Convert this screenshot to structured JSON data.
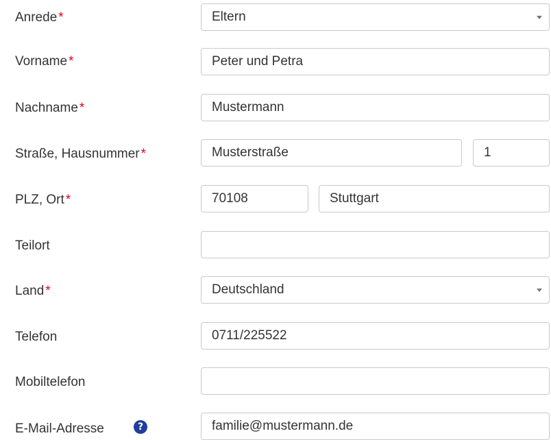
{
  "form": {
    "required_marker": "*",
    "anrede": {
      "label": "Anrede",
      "value": "Eltern"
    },
    "vorname": {
      "label": "Vorname",
      "value": "Peter und Petra"
    },
    "nachname": {
      "label": "Nachname",
      "value": "Mustermann"
    },
    "strasse": {
      "label": "Straße, Hausnummer",
      "street_value": "Musterstraße",
      "number_value": "1"
    },
    "plz_ort": {
      "label": "PLZ, Ort",
      "plz_value": "70108",
      "ort_value": "Stuttgart"
    },
    "teilort": {
      "label": "Teilort",
      "value": ""
    },
    "land": {
      "label": "Land",
      "value": "Deutschland"
    },
    "telefon": {
      "label": "Telefon",
      "value": "0711/225522"
    },
    "mobiltelefon": {
      "label": "Mobiltelefon",
      "value": ""
    },
    "email": {
      "label": "E-Mail-Adresse",
      "value": "familie@mustermann.de",
      "help_glyph": "?"
    }
  },
  "colors": {
    "required": "#e2001a",
    "help_icon": "#1f3f99",
    "border": "#c9c9c9"
  },
  "icons": {
    "select_caret": "chevron-down-icon",
    "help": "question-circle-icon"
  }
}
